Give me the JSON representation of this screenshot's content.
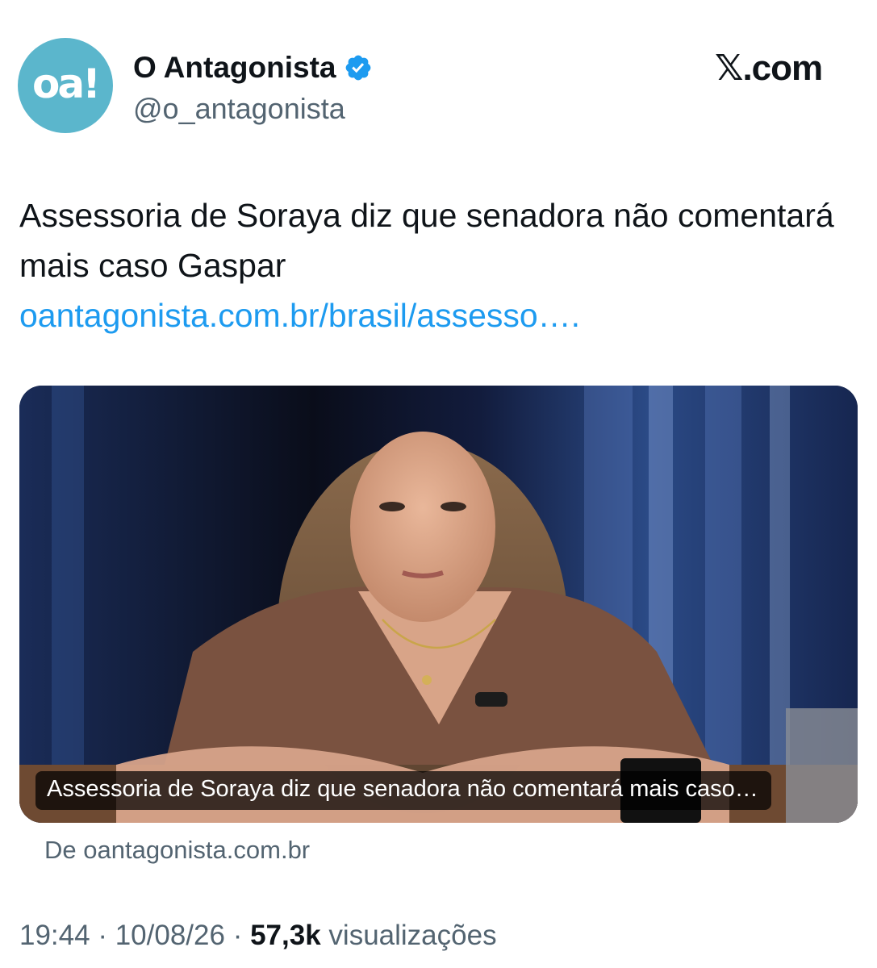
{
  "author": {
    "avatar_text": "oa!",
    "name": "O Antagonista",
    "handle": "@o_antagonista",
    "verified_icon": "verified-badge-icon"
  },
  "brand": {
    "label": "𝕏.com"
  },
  "tweet": {
    "text": "Assessoria de Soraya diz que senadora não comentará mais caso Gaspar",
    "link": "oantagonista.com.br/brasil/assesso….",
    "media_caption": "Assessoria de Soraya diz que senadora não comentará mais caso…",
    "source": "De oantagonista.com.br"
  },
  "meta": {
    "time": "19:44",
    "separator": "·",
    "date": "10/08/26",
    "views_count": "57,3k",
    "views_label": "visualizações"
  },
  "colors": {
    "accent": "#1d9bf0",
    "avatar_bg": "#5bb6cc",
    "secondary_text": "#536471",
    "primary_text": "#0f1419"
  }
}
